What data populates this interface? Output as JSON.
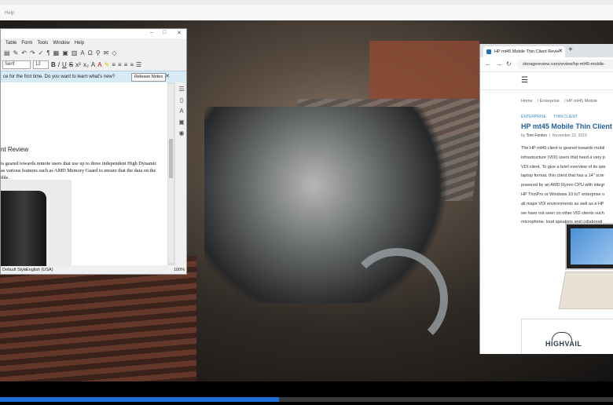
{
  "topbar": {
    "help": "Help"
  },
  "writer": {
    "menu": [
      "Table",
      "Form",
      "Tools",
      "Window",
      "Help"
    ],
    "font_name": "Serif",
    "font_size": "12",
    "style_name": "Default Style",
    "infobar_message": "ce for the first time. Do you want to learn what's new?",
    "infobar_button": "Release Notes",
    "heading": "nt Review",
    "paragraph_lines": [
      "is geared towards remote users that use up to three independent High Dynamic",
      "as various features such as AMD Memory Guard to ensure that the data on the",
      "ible."
    ],
    "status_style": "Default Style",
    "status_lang": "English (USA)",
    "status_zoom": "100%"
  },
  "browser": {
    "tab_title": "HP mt45 Mobile Thin Client Revie",
    "url": "storagereview.com/review/hp-mt45-mobile-",
    "breadcrumb": [
      "Home",
      "Enterprise",
      "HP mt45 Mobile"
    ],
    "categories": [
      "ENTERPRISE",
      "THIN CLIENT"
    ],
    "title": "HP mt45 Mobile Thin Client R",
    "author": "Tom Fenton",
    "author_prefix": "by",
    "date": "November 22, 2019",
    "body_lines": [
      "The HP mt45 client is geared towards mobil",
      "infrastructure (VDI) users that need a very p",
      "VDI client. To give a brief overview of its spe",
      "laptop format, thin client that has a 14\" scre",
      "powered by an AMD Ryzen CPU with integr",
      "HP ThinPro or Windows 10 IoT enterprise o",
      "all major VDI environments as well as a HP",
      "we have not seen on other VID clients such",
      "microphone, loud speakers and collaborati"
    ],
    "ad_logo": "HIGHVAIL"
  },
  "video": {
    "progress": 0.455
  }
}
